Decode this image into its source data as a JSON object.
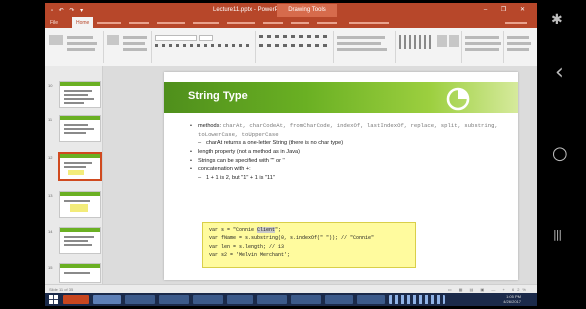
{
  "window": {
    "title": "Lecture11.pptx - PowerPoint",
    "context_tab": "Drawing Tools",
    "controls": "– ❐ ✕",
    "quick_access": "▫ ↶ ↷ ▾"
  },
  "ribbon": {
    "file_tab": "File",
    "home_tab": "Home"
  },
  "slide": {
    "title": "String Type",
    "bullets": [
      {
        "prefix": "methods: ",
        "code": "charAt, charCodeAt, fromCharCode, indexOf, lastIndexOf, replace, split, substring, toLowerCase, toUpperCase"
      },
      {
        "sub": "charAt returns a one-letter String (there is no char type)"
      },
      {
        "text": "length property (not a method as in Java)"
      },
      {
        "text": "Strings can be specified with \"\" or ''"
      },
      {
        "text": "concatenation with +:"
      },
      {
        "sub": "1 + 1 is 2, but \"1\" + 1 is \"11\""
      }
    ],
    "code_lines": [
      {
        "pre": "var s = \"Connie ",
        "hl": "Client",
        "post": "\";"
      },
      {
        "pre": "var fName = s.substring(0, s.indexOf(\" \"));  // \"Connie\"",
        "hl": "",
        "post": ""
      },
      {
        "pre": "var len = s.length;  // 13",
        "hl": "",
        "post": ""
      },
      {
        "pre": "var s2 = 'Melvin Merchant';",
        "hl": "",
        "post": ""
      }
    ]
  },
  "thumbnails": {
    "numbers": [
      "10",
      "11",
      "12",
      "13",
      "14",
      "15"
    ]
  },
  "statusbar": {
    "left": "Slide 11 of 35",
    "right": "▭ ▦ ▤ ▣ — + 62%"
  },
  "clock": {
    "time": "1:05 PM",
    "date": "4/26/2017"
  },
  "phone_nav": {
    "person_icon": "✱",
    "back_icon": "‹",
    "home_icon": "○",
    "recents_icon": "|||"
  },
  "colors": {
    "accent": "#b7472a",
    "slide_green": "#6ab023",
    "code_bg": "#fffb9e"
  }
}
